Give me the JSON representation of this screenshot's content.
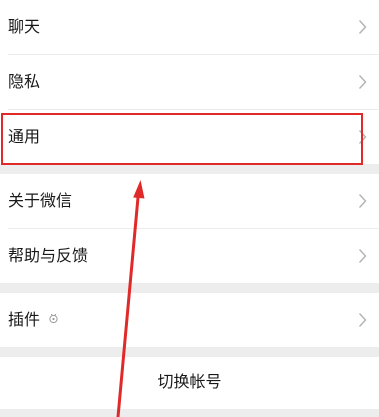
{
  "settings": {
    "items": [
      {
        "label": "聊天",
        "icon": "chevron-right-icon"
      },
      {
        "label": "隐私",
        "icon": "chevron-right-icon"
      },
      {
        "label": "通用",
        "icon": "chevron-right-icon"
      },
      {
        "label": "关于微信",
        "icon": "chevron-right-icon"
      },
      {
        "label": "帮助与反馈",
        "icon": "chevron-right-icon"
      },
      {
        "label": "插件",
        "icon": "chevron-right-icon",
        "badge_icon": "plugin-icon"
      }
    ],
    "switch_account": "切换帐号"
  },
  "annotation": {
    "highlight_color": "#e02a2a",
    "highlight_target": "通用"
  },
  "colors": {
    "background": "#ededed",
    "row": "#ffffff",
    "text": "#191919",
    "chevron": "#b2b2b2"
  }
}
